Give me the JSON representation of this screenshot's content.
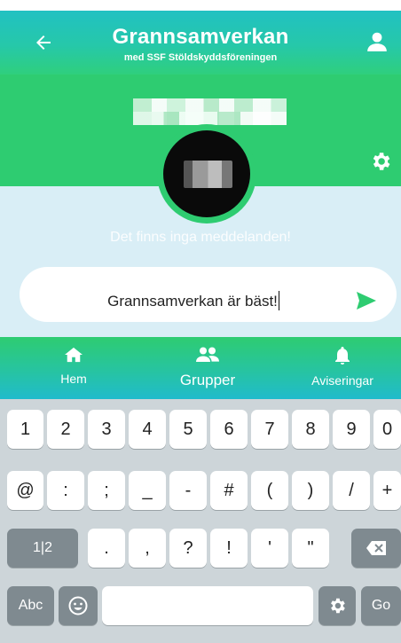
{
  "header": {
    "title": "Grannsamverkan",
    "subtitle": "med SSF Stöldskyddsföreningen"
  },
  "chat": {
    "empty_text": "Det finns inga meddelanden!",
    "message_value": "Grannsamverkan är bäst!"
  },
  "nav": {
    "home_label": "Hem",
    "groups_label": "Grupper",
    "notifications_label": "Aviseringar"
  },
  "keyboard": {
    "row1": [
      "1",
      "2",
      "3",
      "4",
      "5",
      "6",
      "7",
      "8",
      "9",
      "0"
    ],
    "row2": [
      "@",
      ":",
      ";",
      "_",
      "-",
      "#",
      "(",
      ")",
      "/",
      "+"
    ],
    "row3_left": "1|2",
    "row3": [
      ".",
      ",",
      "?",
      "!",
      "'",
      "\""
    ],
    "abc_label": "Abc",
    "go_label": "Go"
  },
  "colors": {
    "green": "#2ecc71",
    "teal": "#20bbcc",
    "chat_bg": "#d9eef6"
  }
}
